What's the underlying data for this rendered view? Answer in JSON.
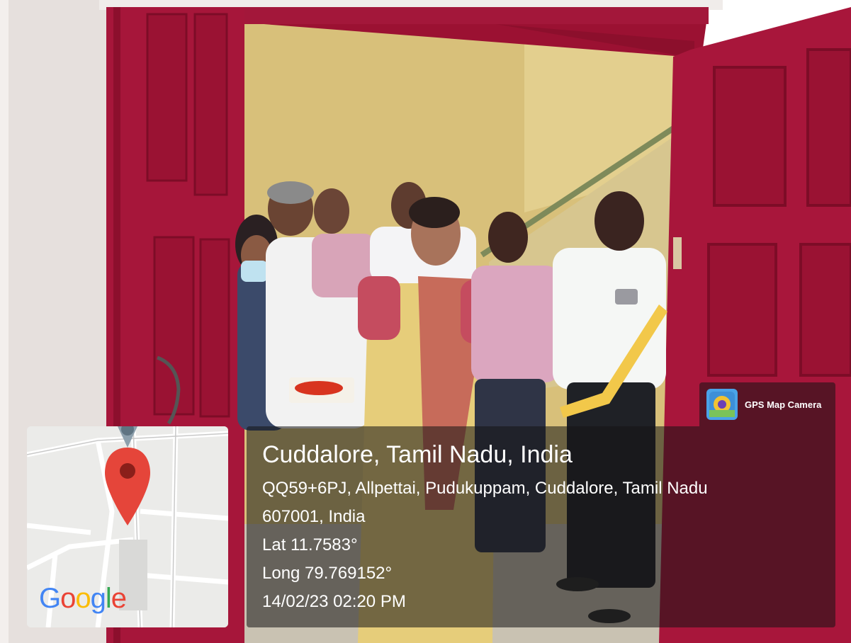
{
  "photo": {
    "alt": "Ribbon-cutting ceremony at a red door with a group of people",
    "colors": {
      "wall": "#e8e2df",
      "door_red": "#a8163b",
      "interior": "#dcc47f",
      "saree_yellow": "#e7cf7c",
      "saree_border": "#c86a5c",
      "ribbon": "#f2c84a"
    }
  },
  "badge": {
    "app_name": "GPS Map Camera",
    "icon": "gps-map-camera-icon"
  },
  "location": {
    "city_line": "Cuddalore, Tamil Nadu, India",
    "address_line1": "QQ59+6PJ, Allpettai, Pudukuppam, Cuddalore, Tamil Nadu",
    "address_line2": "607001, India",
    "lat": "Lat 11.7583°",
    "long": "Long 79.769152°",
    "datetime": "14/02/23 02:20 PM"
  },
  "map": {
    "pin_icon": "map-pin-icon",
    "logo": "Google",
    "pin_color": "#e5453a"
  }
}
